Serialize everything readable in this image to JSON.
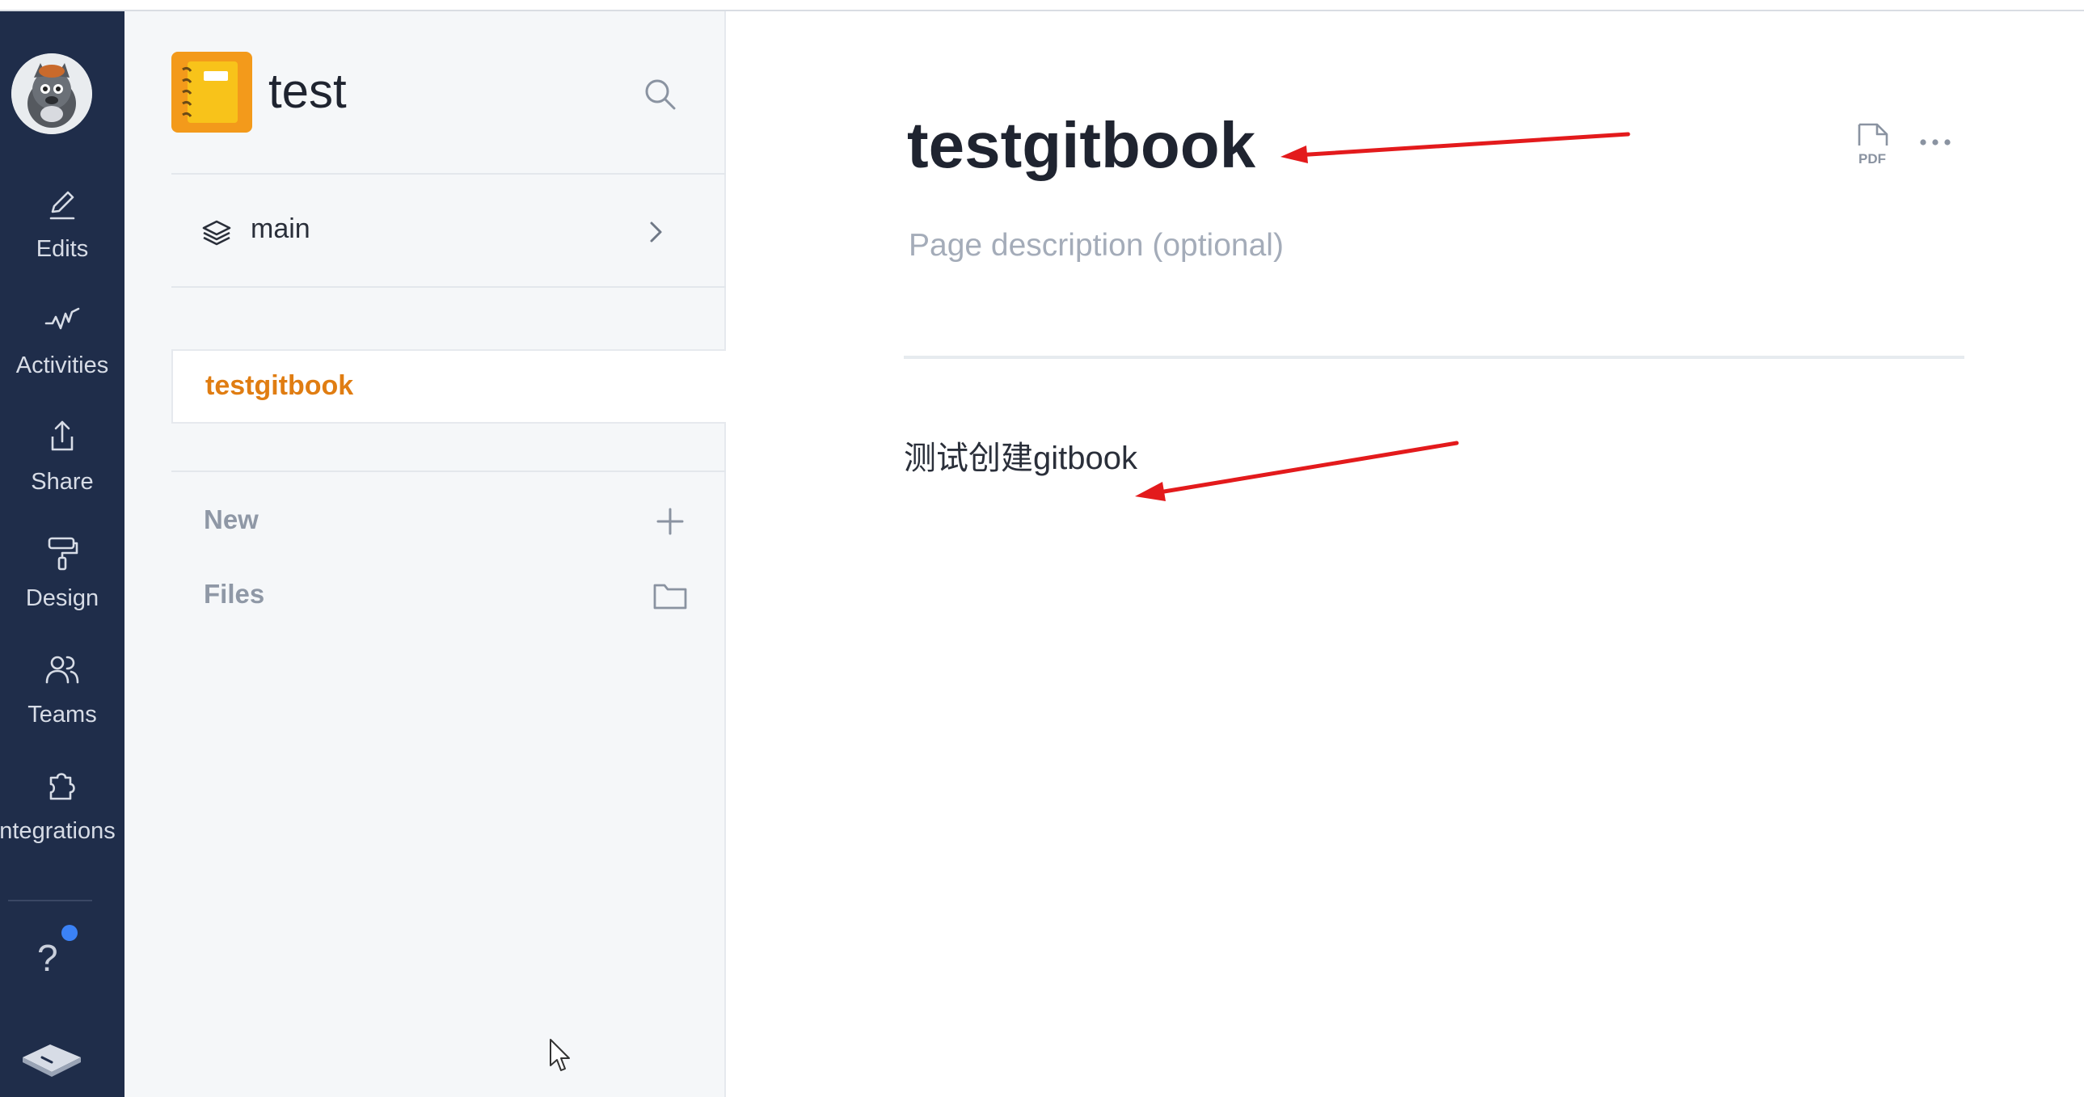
{
  "rail": {
    "items": [
      {
        "label": "Edits",
        "icon": "pencil-icon"
      },
      {
        "label": "Activities",
        "icon": "activity-icon"
      },
      {
        "label": "Share",
        "icon": "share-icon"
      },
      {
        "label": "Design",
        "icon": "paint-roller-icon"
      },
      {
        "label": "Teams",
        "icon": "users-icon"
      },
      {
        "label": "ntegrations",
        "icon": "puzzle-icon"
      }
    ],
    "help_label": "?",
    "accent_color": "#1f2d4a",
    "notification_color": "#3b82f6"
  },
  "sidebar": {
    "space_title": "test",
    "branch": "main",
    "pages": [
      {
        "label": "testgitbook"
      }
    ],
    "actions": [
      {
        "label": "New",
        "icon": "plus-icon"
      },
      {
        "label": "Files",
        "icon": "folder-icon"
      }
    ],
    "active_color": "#e07d12"
  },
  "main": {
    "title": "testgitbook",
    "description_placeholder": "Page description (optional)",
    "body_text": "测试创建gitbook",
    "pdf_label": "PDF",
    "more_label": "···"
  },
  "annotations": {
    "arrow_color": "#e31a1c"
  }
}
